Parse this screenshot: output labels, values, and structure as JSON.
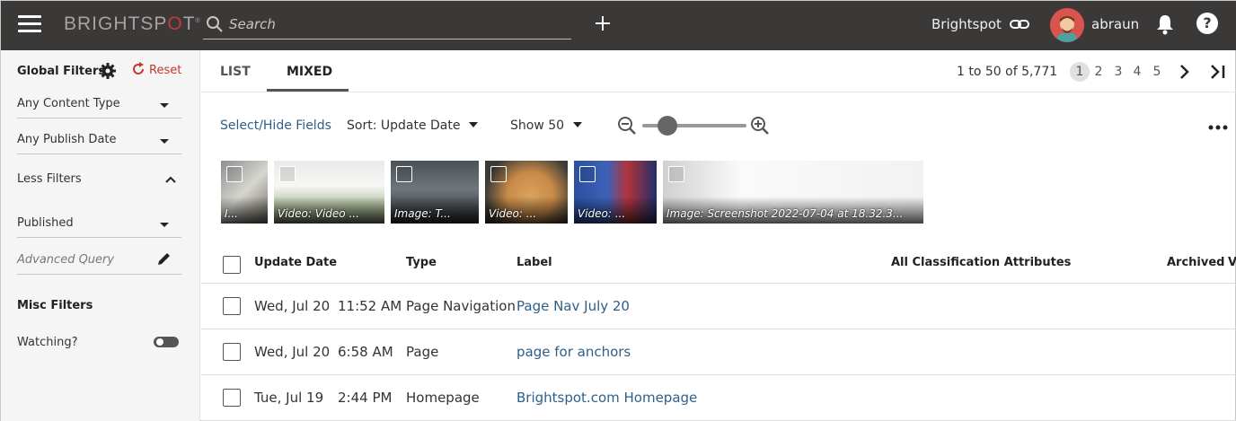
{
  "header": {
    "brand_main": "BRIGHTSP",
    "brand_o": "O",
    "brand_end": "T",
    "brand_mark": "®",
    "search_placeholder": "Search",
    "site": "Brightspot",
    "username": "abraun",
    "help": "?"
  },
  "sidebar": {
    "title": "Global Filters",
    "reset": "Reset",
    "content_type": "Any Content Type",
    "publish_date": "Any Publish Date",
    "less_filters": "Less Filters",
    "status": "Published",
    "advanced_query": "Advanced Query",
    "misc_title": "Misc Filters",
    "watching": "Watching?",
    "watching_on": false
  },
  "tabs": [
    {
      "label": "LIST",
      "active": false
    },
    {
      "label": "MIXED",
      "active": true
    }
  ],
  "pagination": {
    "range": "1 to 50 of 5,771",
    "pages": [
      "1",
      "2",
      "3",
      "4",
      "5"
    ],
    "current": "1"
  },
  "toolbar": {
    "select_fields": "Select/Hide Fields",
    "sort": "Sort: Update Date",
    "show": "Show 50",
    "zoom_level": 0.2
  },
  "thumbnails": [
    {
      "caption": "I..."
    },
    {
      "caption": "Video: Video ..."
    },
    {
      "caption": "Image: T..."
    },
    {
      "caption": "Video: ..."
    },
    {
      "caption": "Video: ..."
    },
    {
      "caption": "Image: Screenshot 2022-07-04 at 18.32.3..."
    }
  ],
  "table": {
    "columns": [
      "Update Date",
      "Type",
      "Label",
      "All Classification Attributes",
      "Archived",
      "V"
    ],
    "rows": [
      {
        "date": "Wed, Jul 20",
        "time": "11:52 AM",
        "type": "Page Navigation",
        "label": "Page Nav July 20"
      },
      {
        "date": "Wed, Jul 20",
        "time": "6:58 AM",
        "type": "Page",
        "label": "page for anchors"
      },
      {
        "date": "Tue, Jul 19",
        "time": "2:44 PM",
        "type": "Homepage",
        "label": "Brightspot.com Homepage"
      }
    ]
  },
  "colors": {
    "topbar": "#3b3838",
    "link": "#2d5f8a",
    "reset": "#c0392b",
    "logo_accent": "#c13a3f"
  }
}
